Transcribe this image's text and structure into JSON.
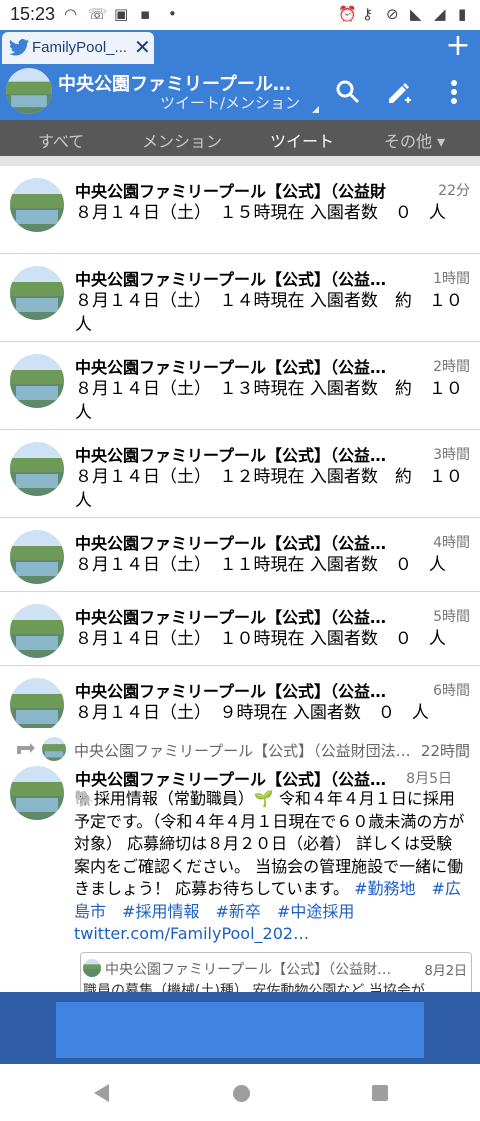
{
  "statusbar": {
    "time": "15:23"
  },
  "tab": {
    "label": "FamilyPool_..."
  },
  "header": {
    "title": "中央公園ファミリープール…",
    "subtitle": "ツイート/メンション"
  },
  "filters": {
    "all": "すべて",
    "mentions": "メンション",
    "tweets": "ツイート",
    "other": "その他"
  },
  "tweets": [
    {
      "name": "中央公園ファミリープール【公式】（公益財",
      "time": "22分",
      "text": "８月１４日（土）　１５時現在 入園者数　０　人"
    },
    {
      "name": "中央公園ファミリープール【公式】（公益…",
      "time": "1時間",
      "text": "８月１４日（土）　１４時現在 入園者数　約　１０\n人"
    },
    {
      "name": "中央公園ファミリープール【公式】（公益…",
      "time": "2時間",
      "text": "８月１４日（土）　１３時現在 入園者数　約　１０\n人"
    },
    {
      "name": "中央公園ファミリープール【公式】（公益…",
      "time": "3時間",
      "text": "８月１４日（土）　１２時現在 入園者数　約　１０\n人"
    },
    {
      "name": "中央公園ファミリープール【公式】（公益…",
      "time": "4時間",
      "text": "８月１４日（土）　１１時現在 入園者数　０　人"
    },
    {
      "name": "中央公園ファミリープール【公式】（公益…",
      "time": "5時間",
      "text": "８月１４日（土）　１０時現在 入園者数　０　人"
    },
    {
      "name": "中央公園ファミリープール【公式】（公益…",
      "time": "6時間",
      "text": "８月１４日（土）　９時現在 入園者数　０　人"
    }
  ],
  "retweet": {
    "retweeter": "中央公園ファミリープール【公式】（公益財団法…",
    "retweet_time": "22時間",
    "name": "中央公園ファミリープール【公式】（公益…",
    "time": "8月5日",
    "text_a": "🐘採用情報（常勤職員）🌱 令和４年４月１日に採用予定です。（令和４年４月１日現在で６０歳未満の方が対象） 応募締切は８月２０日（必着） 詳しくは受験案内をご確認ください。 当協会の管理施設で一緒に働きましょう！ 応募お待ちしています。 ",
    "tag1": "#勤務地",
    "tag2": "#広島市",
    "tag3": "#採用情報",
    "tag4": "#新卒",
    "tag5": "#中途採用",
    "link": "twitter.com/FamilyPool_202…",
    "quote": {
      "name": "中央公園ファミリープール【公式】（公益財…",
      "time": "8月2日",
      "text": "職員の募集（機械(土)種） 安佐動物公園など 当協会が"
    }
  },
  "colors": {
    "accent": "#3b7fd6",
    "filterbar": "#585858",
    "link": "#1b5fc4"
  }
}
